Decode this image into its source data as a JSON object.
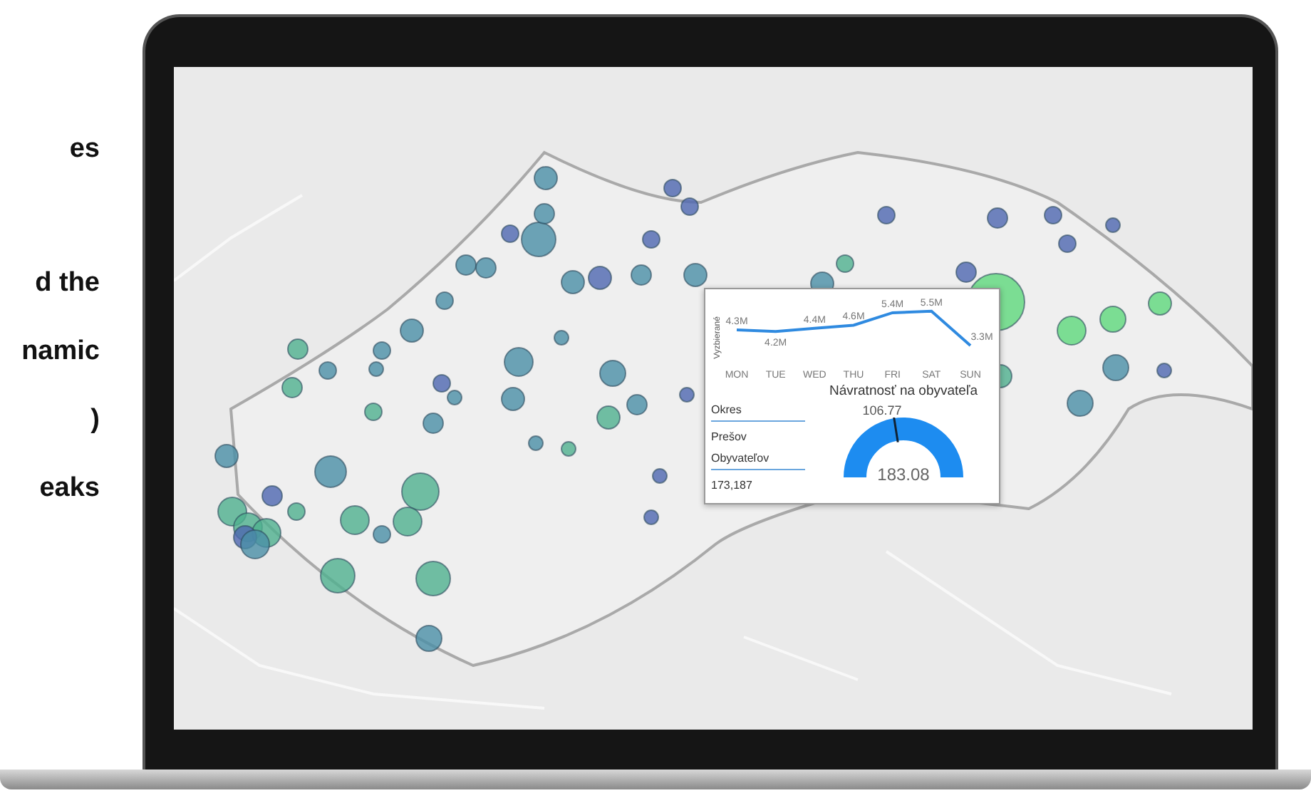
{
  "side_text": {
    "lines": [
      "es",
      "d the",
      "namic",
      ")",
      "eaks"
    ]
  },
  "tooltip": {
    "chart_data": {
      "type": "line",
      "ylabel": "Vyzbierané",
      "categories": [
        "MON",
        "TUE",
        "WED",
        "THU",
        "FRI",
        "SAT",
        "SUN"
      ],
      "series": [
        {
          "color": "#2f8ae0",
          "values": [
            4.3,
            4.2,
            4.4,
            4.6,
            5.4,
            5.5,
            3.3
          ],
          "value_labels": [
            "4.3M",
            "4.2M",
            "4.4M",
            "4.6M",
            "5.4M",
            "5.5M",
            "3.3M"
          ]
        }
      ],
      "data_labels": true
    },
    "slicers": [
      {
        "label": "Okres",
        "value": "Prešov"
      },
      {
        "label": "Obyvateľov",
        "value": "173,187"
      }
    ],
    "gauge": {
      "title": "Návratnosť na obyvateľa",
      "value": "183.08",
      "target": "106.77"
    }
  }
}
